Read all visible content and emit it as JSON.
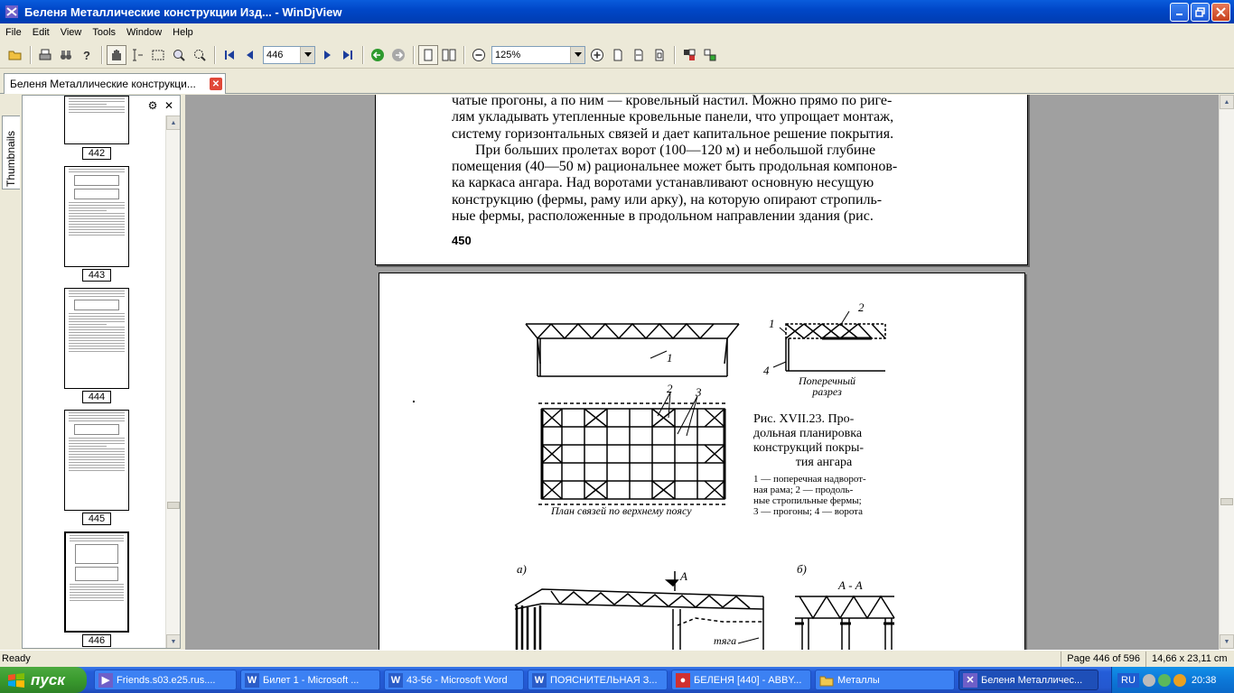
{
  "window": {
    "title": "Беленя Металлические конструкции Изд... - WinDjView"
  },
  "menu": [
    "File",
    "Edit",
    "View",
    "Tools",
    "Window",
    "Help"
  ],
  "toolbar": {
    "page_number": "446",
    "zoom": "125%"
  },
  "document_tab": {
    "title": "Беленя Металлические конструкци..."
  },
  "sidebar": {
    "tab_label": "Thumbnails",
    "thumbnails": [
      {
        "page": "442"
      },
      {
        "page": "443"
      },
      {
        "page": "444"
      },
      {
        "page": "445"
      },
      {
        "page": "446"
      }
    ]
  },
  "page_top": {
    "lines": [
      "чатые прогоны, а по ним — кровельный настил. Можно прямо по риге-",
      "лям укладывать утепленные кровельные панели, что упрощает монтаж,",
      "систему горизонтальных связей и дает капитальное решение покрытия.",
      "При больших пролетах ворот (100—120 м) и небольшой глубине",
      "помещения (40—50 м) рациональнее может быть продольная компонов-",
      "ка каркаса ангара. Над воротами устанавливают основную несущую",
      "конструкцию (фермы, раму или арку), на которую опирают стропиль-",
      "ные фермы, расположенные в продольном направлении здания (рис."
    ],
    "page_number": "450"
  },
  "page_figure": {
    "figure_title": [
      "Рис. XVII.23. Про-",
      "дольная планировка",
      "конструкций покры-",
      "тия ангара"
    ],
    "legend": [
      "1 — поперечная надворот-",
      "ная рама; 2 — продоль-",
      "ные стропильные фермы;",
      "3 — прогоны; 4 — ворота"
    ],
    "labels": {
      "section": [
        "Поперечный",
        "разрез"
      ],
      "plan": "План связей по верхнему поясу",
      "a": "а)",
      "b": "б)",
      "cut": "А",
      "section_aa": "А - А",
      "tie": "тяга",
      "n1": "1",
      "n2": "2",
      "n3": "3",
      "n4": "4"
    }
  },
  "status": {
    "ready": "Ready",
    "page_info": "Page 446 of 596",
    "size": "14,66 x 23,11 cm"
  },
  "taskbar": {
    "start": "пуск",
    "tasks": [
      "Friends.s03.e25.rus....",
      "Билет 1 - Microsoft ...",
      "43-56 - Microsoft Word",
      "ПОЯСНИТЕЛЬНАЯ З...",
      "БЕЛЕНЯ [440] - ABBY...",
      "Металлы",
      "Беленя Металличес..."
    ],
    "lang": "RU",
    "clock": "20:38"
  }
}
